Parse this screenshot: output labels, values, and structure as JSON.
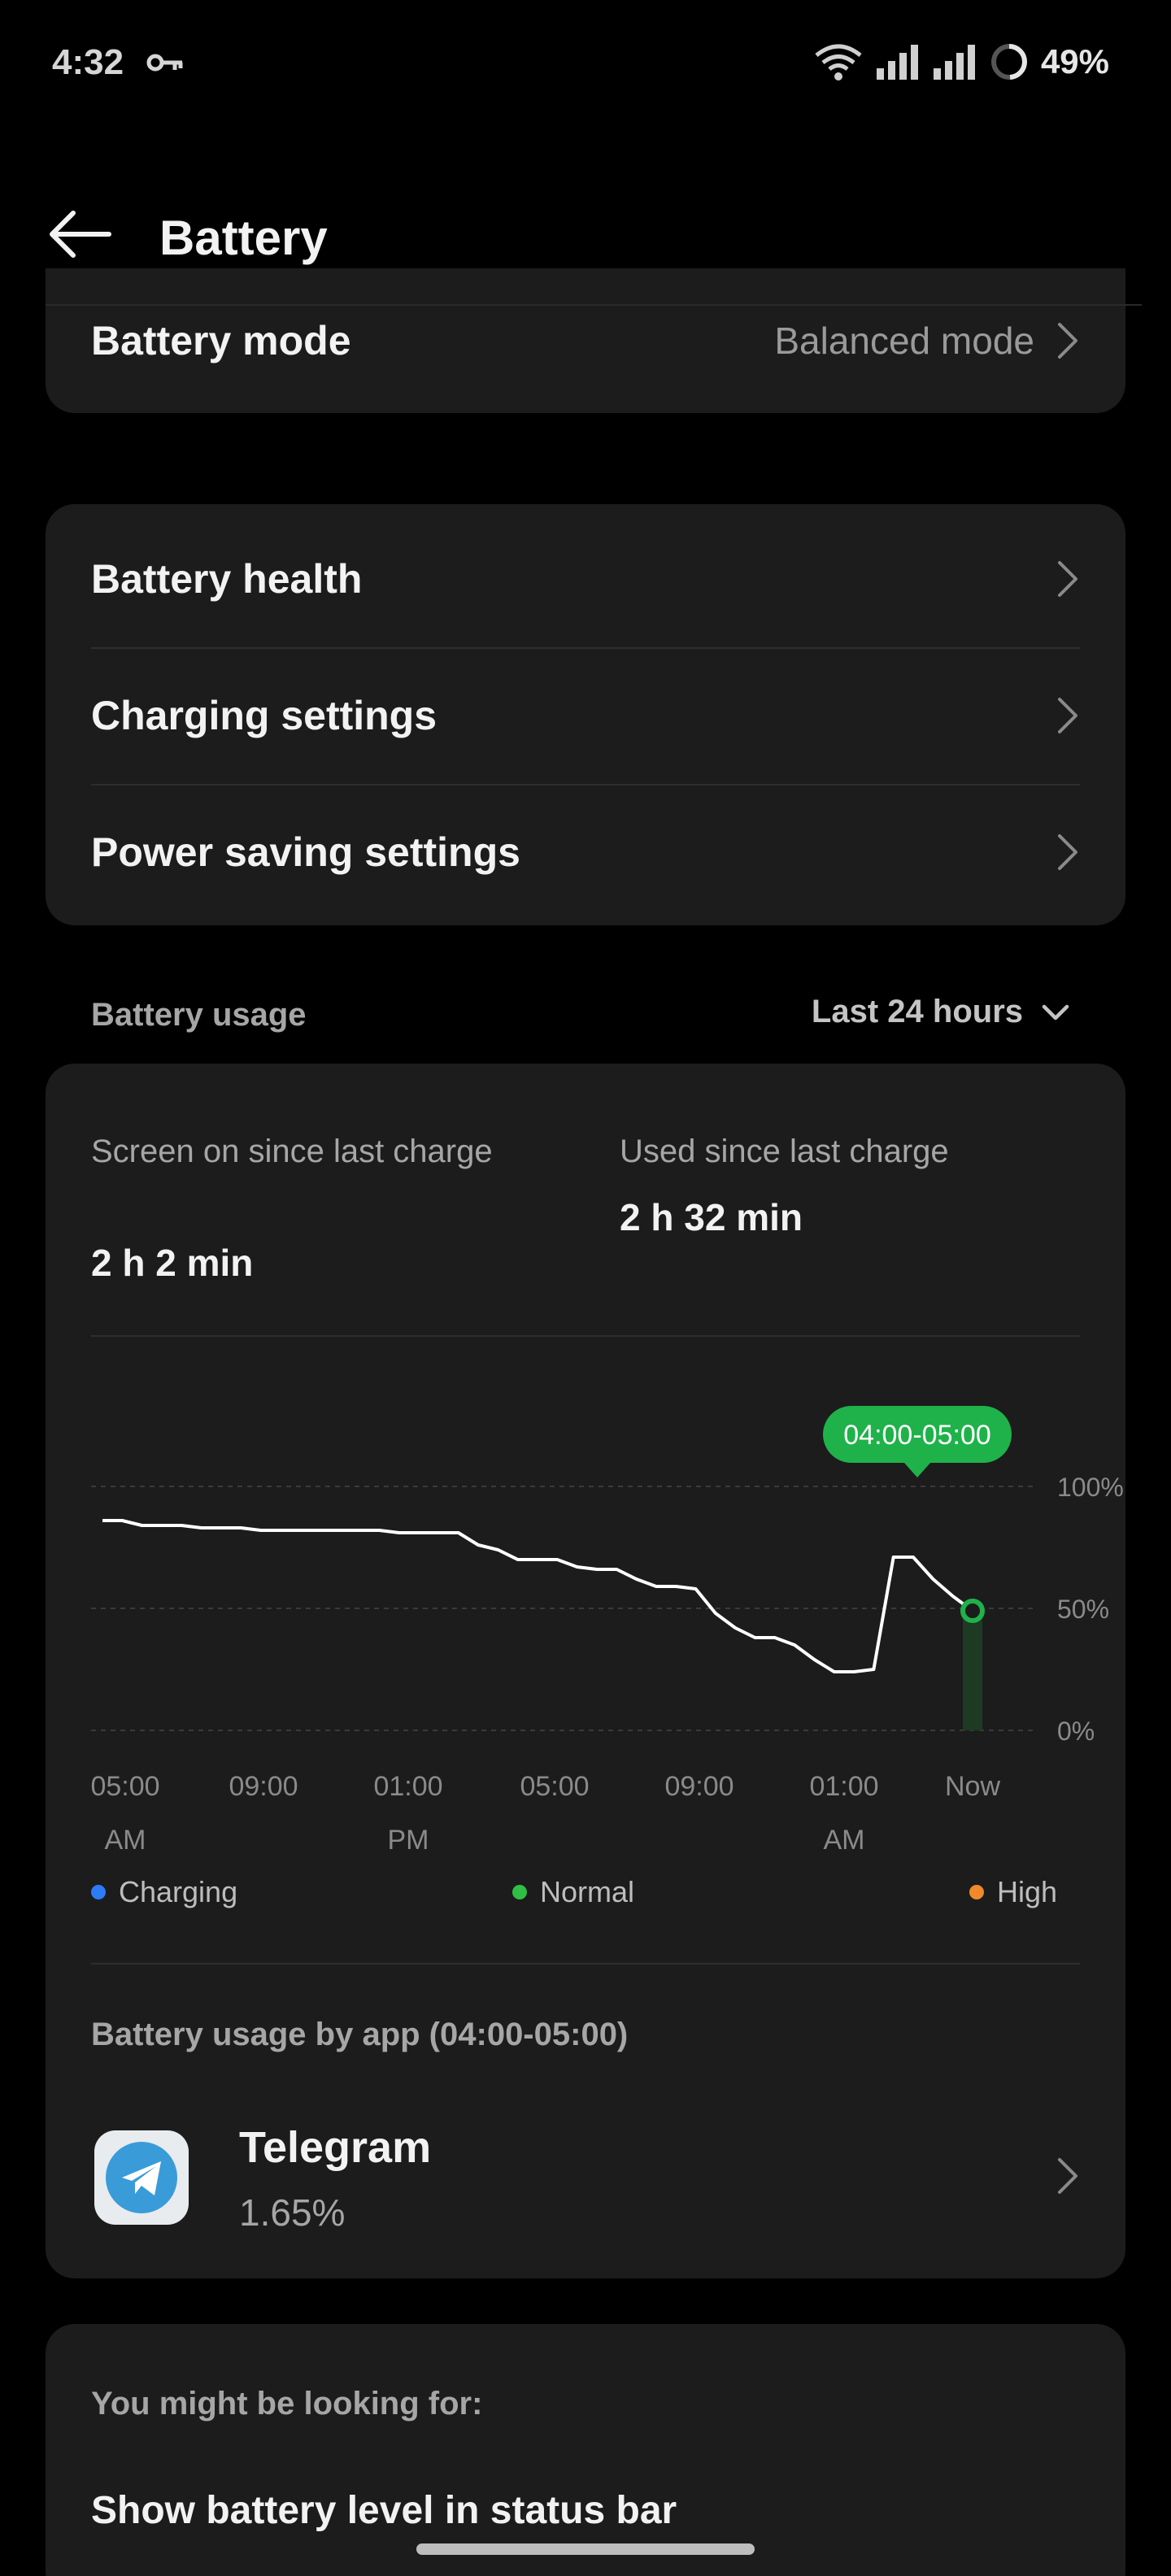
{
  "status_bar": {
    "time": "4:32",
    "battery_percent": "49%",
    "icons": [
      "key-icon",
      "wifi-icon",
      "signal-icon",
      "signal-icon",
      "battery-ring-icon"
    ],
    "battery_level": 0.49
  },
  "header": {
    "title": "Battery",
    "back_icon": "arrow-left-icon"
  },
  "battery_mode": {
    "label": "Battery mode",
    "value": "Balanced mode"
  },
  "settings": {
    "items": [
      {
        "label": "Battery health"
      },
      {
        "label": "Charging settings"
      },
      {
        "label": "Power saving settings"
      }
    ]
  },
  "usage": {
    "section_label": "Battery usage",
    "period": "Last 24 hours",
    "screen_on_label": "Screen on since last charge",
    "screen_on_value": "2 h 2 min",
    "used_label": "Used since last charge",
    "used_value": "2 h 32 min"
  },
  "chart_data": {
    "type": "line",
    "ylim": [
      0,
      100
    ],
    "y_ticks": [
      "100%",
      "50%",
      "0%"
    ],
    "x_ticks": [
      [
        "05:00",
        "AM"
      ],
      [
        "09:00",
        ""
      ],
      [
        "01:00",
        "PM"
      ],
      [
        "05:00",
        ""
      ],
      [
        "09:00",
        ""
      ],
      [
        "01:00",
        "AM"
      ],
      [
        "Now",
        ""
      ]
    ],
    "tooltip": "04:00-05:00",
    "series": [
      {
        "values": [
          86,
          86,
          84,
          84,
          84,
          83,
          83,
          83,
          82,
          82,
          82,
          82,
          82,
          82,
          82,
          81,
          81,
          81,
          81,
          76,
          74,
          70,
          70,
          70,
          67,
          66,
          66,
          62,
          59,
          59,
          58,
          48,
          42,
          38,
          38,
          35,
          29,
          24,
          24,
          25,
          71,
          71,
          62,
          55,
          49
        ]
      }
    ],
    "colors": {
      "line": "#ffffff",
      "accent": "#1fb24a"
    }
  },
  "legend": {
    "charging": "Charging",
    "normal": "Normal",
    "high": "High",
    "colors": {
      "charging": "#2b7cf6",
      "normal": "#2fbf45",
      "high": "#f0892a"
    }
  },
  "by_app": {
    "title": "Battery usage by app (04:00-05:00)",
    "apps": [
      {
        "name": "Telegram",
        "percent": "1.65%",
        "icon": "telegram-icon"
      }
    ]
  },
  "looking_for": {
    "title": "You might be looking for:",
    "items": [
      "Show battery level in status bar"
    ]
  }
}
